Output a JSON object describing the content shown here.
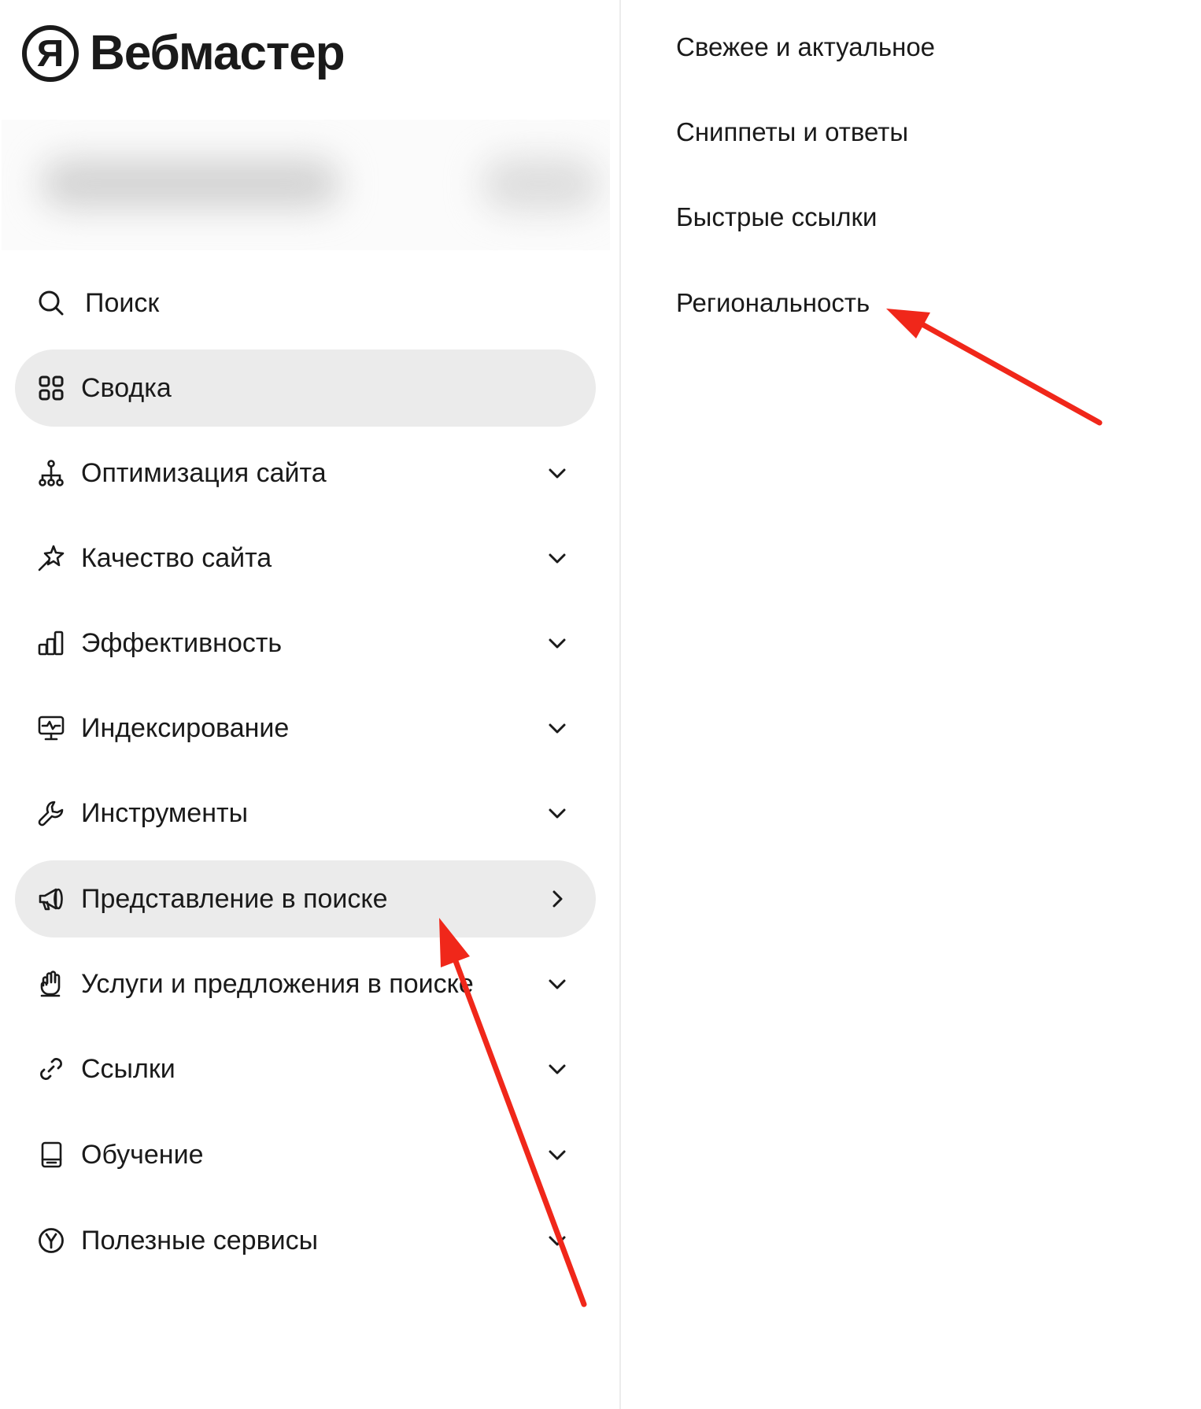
{
  "logo": {
    "mark": "Я",
    "title": "Вебмастер"
  },
  "sidebar": {
    "items": [
      {
        "label": "Поиск",
        "icon": "search-icon",
        "chevron": "none",
        "active": false
      },
      {
        "label": "Сводка",
        "icon": "grid-icon",
        "chevron": "none",
        "active": true
      },
      {
        "label": "Оптимизация сайта",
        "icon": "sitemap-icon",
        "chevron": "down",
        "active": false
      },
      {
        "label": "Качество сайта",
        "icon": "sparkle-wand-icon",
        "chevron": "down",
        "active": false
      },
      {
        "label": "Эффективность",
        "icon": "bar-chart-icon",
        "chevron": "down",
        "active": false
      },
      {
        "label": "Индексирование",
        "icon": "monitor-pulse-icon",
        "chevron": "down",
        "active": false
      },
      {
        "label": "Инструменты",
        "icon": "wrench-icon",
        "chevron": "down",
        "active": false
      },
      {
        "label": "Представление в поиске",
        "icon": "megaphone-icon",
        "chevron": "right",
        "active": true
      },
      {
        "label": "Услуги и предложения в поиске",
        "icon": "hand-icon",
        "chevron": "down",
        "active": false
      },
      {
        "label": "Ссылки",
        "icon": "link-icon",
        "chevron": "down",
        "active": false
      },
      {
        "label": "Обучение",
        "icon": "book-icon",
        "chevron": "down",
        "active": false
      },
      {
        "label": "Полезные сервисы",
        "icon": "yandex-circle-icon",
        "chevron": "down",
        "active": false
      }
    ]
  },
  "submenu": {
    "items": [
      {
        "label": "Свежее и актуальное"
      },
      {
        "label": "Сниппеты и ответы"
      },
      {
        "label": "Быстрые ссылки"
      },
      {
        "label": "Региональность"
      }
    ]
  },
  "annotation": {
    "arrow_color": "#f0271a"
  }
}
